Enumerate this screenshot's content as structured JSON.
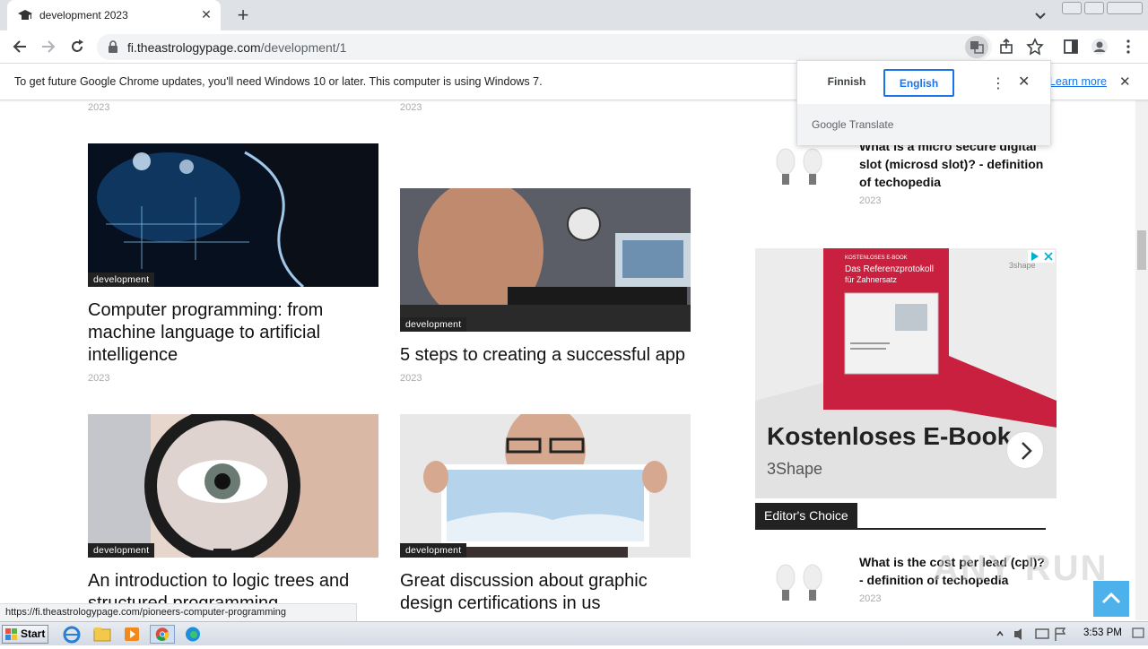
{
  "browser": {
    "tab_title": "development 2023",
    "url_host": "fi.theastrologypage.com",
    "url_path": "/development/1",
    "status_url": "https://fi.theastrologypage.com/pioneers-computer-programming"
  },
  "infobar": {
    "message": "To get future Google Chrome updates, you'll need Windows 10 or later. This computer is using Windows 7.",
    "learn_more": "Learn more"
  },
  "translate": {
    "source_lang": "Finnish",
    "target_lang": "English",
    "footer": "Google Translate"
  },
  "articles": {
    "top_years": [
      "2023",
      "2023"
    ],
    "items": [
      {
        "tag": "development",
        "title": "Computer programming: from machine language to artificial intelligence",
        "year": "2023"
      },
      {
        "tag": "development",
        "title": "5 steps to creating a successful app",
        "year": "2023"
      },
      {
        "tag": "development",
        "title": "An introduction to logic trees and structured programming",
        "year": ""
      },
      {
        "tag": "development",
        "title": "Great discussion about graphic design certifications in us",
        "year": ""
      }
    ]
  },
  "sidebar": {
    "item1": {
      "title": "What is a micro secure digital slot (microsd slot)? - definition of techopedia",
      "year": "2023"
    },
    "ad": {
      "headline": "Kostenloses E-Book",
      "brand": "3Shape",
      "book_title": "Das Referenzprotokoll",
      "book_sub": "für Zahnersatz",
      "book_kicker": "KOSTENLOSES E-BOOK",
      "logo": "3shape"
    },
    "editors_choice": "Editor's Choice",
    "item2": {
      "title": "What is the cost per lead (cpl)? - definition of techopedia",
      "year": "2023"
    }
  },
  "taskbar": {
    "start": "Start",
    "clock": "3:53 PM"
  },
  "watermark": "ANY RUN",
  "colors": {
    "accent_blue": "#1a73e8",
    "scroll_top": "#4db2ec",
    "ad_red": "#c8203e"
  }
}
